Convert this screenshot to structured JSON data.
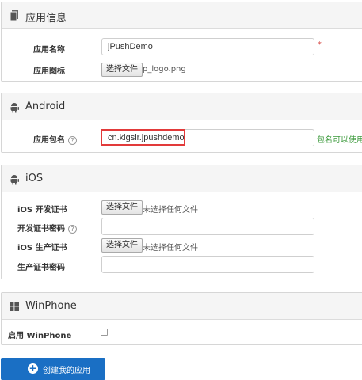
{
  "app_info": {
    "title": "应用信息",
    "name_label": "应用名称",
    "name_value": "jPushDemo",
    "required_mark": "*",
    "icon_label": "应用图标",
    "icon_button": "选择文件",
    "icon_file": "p_logo.png"
  },
  "android": {
    "title": "Android",
    "package_label": "应用包名",
    "help": "?",
    "package_value": "cn.kigsir.jpushdemo",
    "package_status": "包名可以使用"
  },
  "ios": {
    "title": "iOS",
    "dev_cert_label": "iOS 开发证书",
    "dev_cert_button": "选择文件",
    "dev_cert_file": "未选择任何文件",
    "dev_pass_label": "开发证书密码",
    "help": "?",
    "prod_cert_label": "iOS 生产证书",
    "prod_cert_button": "选择文件",
    "prod_cert_file": "未选择任何文件",
    "prod_pass_label": "生产证书密码"
  },
  "winphone": {
    "title": "WinPhone",
    "enable_label": "启用 WinPhone"
  },
  "create_button": {
    "icon": "+",
    "label": "创建我的应用"
  }
}
